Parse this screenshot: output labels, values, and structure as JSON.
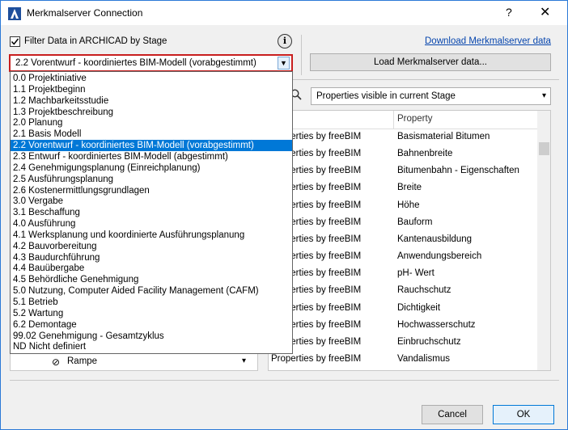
{
  "window": {
    "title": "Merkmalserver Connection",
    "help_glyph": "?",
    "close_glyph": "✕"
  },
  "filter": {
    "checkbox_label": "Filter Data in ARCHICAD by Stage",
    "checked": true,
    "selected_stage": "2.2 Vorentwurf - koordiniertes BIM-Modell (vorabgestimmt)",
    "stages": [
      "0.0 Projektiniative",
      "1.1 Projektbeginn",
      "1.2 Machbarkeitsstudie",
      "1.3 Projektbeschreibung",
      "2.0 Planung",
      "2.1 Basis Modell",
      "2.2 Vorentwurf - koordiniertes BIM-Modell (vorabgestimmt)",
      "2.3 Entwurf - koordiniertes BIM-Modell (abgestimmt)",
      "2.4 Genehmigungsplanung (Einreichplanung)",
      "2.5 Ausführungsplanung",
      "2.6 Kostenermittlungsgrundlagen",
      "3.0 Vergabe",
      "3.1 Beschaffung",
      "4.0 Ausführung",
      "4.1 Werksplanung und koordinierte Ausführungsplanung",
      "4.2 Bauvorbereitung",
      "4.3 Baudurchführung",
      "4.4 Bauübergabe",
      "4.5 Behördliche Genehmigung",
      "5.0 Nutzung, Computer Aided Facility Management (CAFM)",
      "5.1 Betrieb",
      "5.2 Wartung",
      "6.2 Demontage",
      "99.02 Genehmigung - Gesamtzyklus",
      "ND Nicht definiert"
    ]
  },
  "toolbar": {
    "download_link": "Download Merkmalserver data",
    "load_button": "Load Merkmalserver data..."
  },
  "left_panel": {
    "visible_item": "Rampe"
  },
  "right_panel": {
    "visibility_filter": "Properties visible in current Stage",
    "col1_header_fragment": "p",
    "col2_header": "Property",
    "rows": [
      {
        "group": "Properties by freeBIM",
        "property": "Basismaterial Bitumen"
      },
      {
        "group": "Properties by freeBIM",
        "property": "Bahnenbreite"
      },
      {
        "group": "Properties by freeBIM",
        "property": "Bitumenbahn - Eigenschaften"
      },
      {
        "group": "Properties by freeBIM",
        "property": "Breite"
      },
      {
        "group": "Properties by freeBIM",
        "property": "Höhe"
      },
      {
        "group": "Properties by freeBIM",
        "property": "Bauform"
      },
      {
        "group": "Properties by freeBIM",
        "property": "Kantenausbildung"
      },
      {
        "group": "Properties by freeBIM",
        "property": "Anwendungsbereich"
      },
      {
        "group": "Properties by freeBIM",
        "property": "pH- Wert"
      },
      {
        "group": "Properties by freeBIM",
        "property": "Rauchschutz"
      },
      {
        "group": "Properties by freeBIM",
        "property": "Dichtigkeit"
      },
      {
        "group": "Properties by freeBIM",
        "property": "Hochwasserschutz"
      },
      {
        "group": "Properties by freeBIM",
        "property": "Einbruchschutz"
      },
      {
        "group": "Properties by freeBIM",
        "property": "Vandalismus"
      }
    ]
  },
  "footer": {
    "cancel_label": "Cancel",
    "ok_label": "OK"
  },
  "colors": {
    "accent": "#0078d7",
    "highlight_border": "#c81e1e",
    "link": "#0645ad"
  }
}
